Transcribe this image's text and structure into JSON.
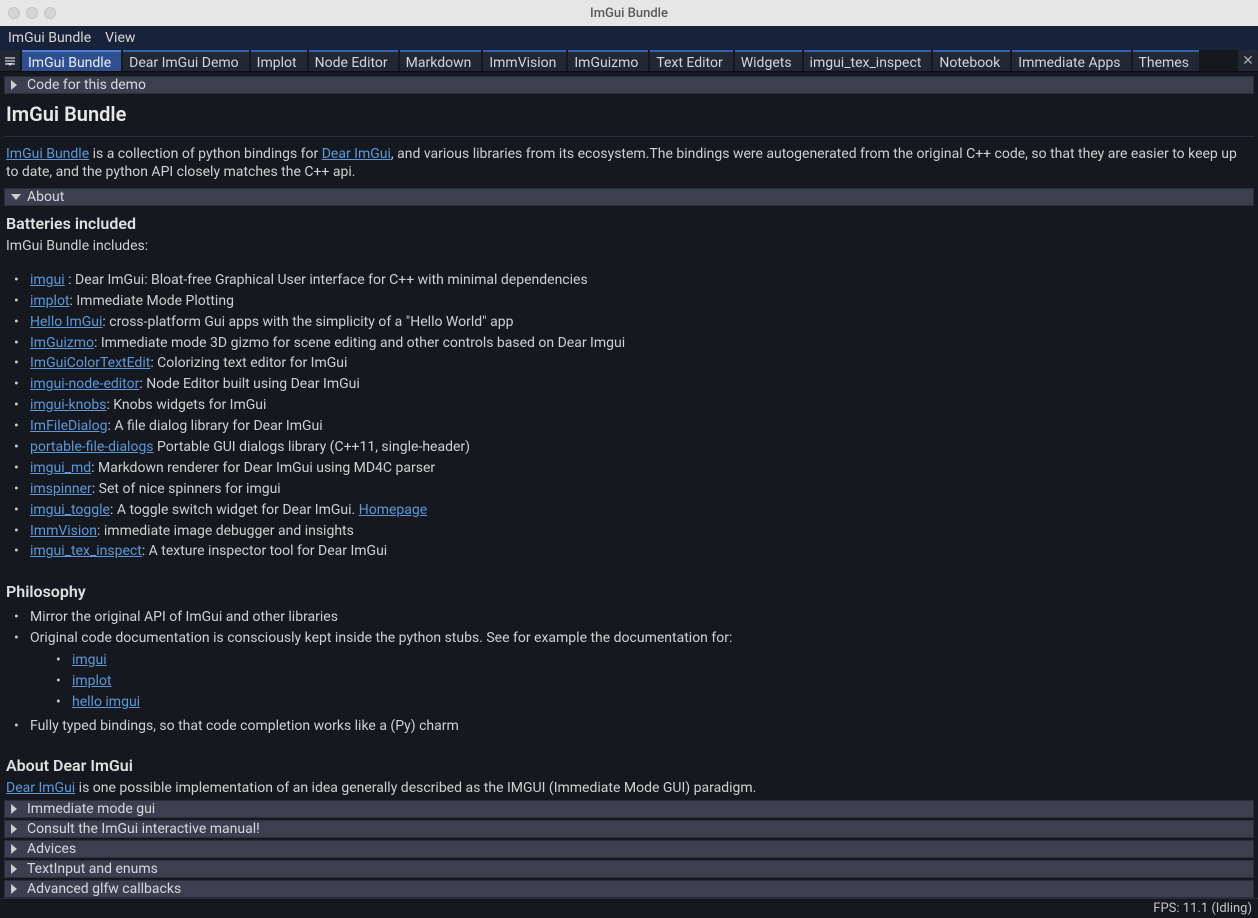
{
  "window": {
    "title": "ImGui Bundle"
  },
  "menubar": [
    "ImGui Bundle",
    "View"
  ],
  "tabs": [
    "ImGui Bundle",
    "Dear ImGui Demo",
    "Implot",
    "Node Editor",
    "Markdown",
    "ImmVision",
    "ImGuizmo",
    "Text Editor",
    "Widgets",
    "imgui_tex_inspect",
    "Notebook",
    "Immediate Apps",
    "Themes"
  ],
  "active_tab_index": 0,
  "collapsers": {
    "code_demo": "Code for this demo",
    "about": "About",
    "imm_mode": "Immediate mode gui",
    "consult": "Consult the ImGui interactive manual!",
    "advices": "Advices",
    "textinput": "TextInput and enums",
    "glfw": "Advanced glfw callbacks"
  },
  "heading": "ImGui Bundle",
  "intro": {
    "link1": "ImGui Bundle",
    "t1": " is a collection of python bindings for ",
    "link2": "Dear ImGui",
    "t2": ", and various libraries from its ecosystem.The bindings were autogenerated from the original C++ code, so that they are easier to keep up to date, and the python API closely matches the C++ api."
  },
  "batteries_heading": "Batteries included",
  "batteries_intro": "ImGui Bundle includes:",
  "items": [
    {
      "link": "imgui",
      "text": " : Dear ImGui: Bloat-free Graphical User interface for C++ with minimal dependencies"
    },
    {
      "link": "implot",
      "text": ": Immediate Mode Plotting"
    },
    {
      "link": "Hello ImGui",
      "text": ": cross-platform Gui apps with the simplicity of a \"Hello World\" app"
    },
    {
      "link": "ImGuizmo",
      "text": ": Immediate mode 3D gizmo for scene editing and other controls based on Dear Imgui"
    },
    {
      "link": "ImGuiColorTextEdit",
      "text": ": Colorizing text editor for ImGui"
    },
    {
      "link": "imgui-node-editor",
      "text": ": Node Editor built using Dear ImGui"
    },
    {
      "link": "imgui-knobs",
      "text": ": Knobs widgets for ImGui"
    },
    {
      "link": "ImFileDialog",
      "text": ": A file dialog library for Dear ImGui"
    },
    {
      "link": "portable-file-dialogs",
      "text": "  Portable GUI dialogs library (C++11, single-header)"
    },
    {
      "link": "imgui_md",
      "text": ": Markdown renderer for Dear ImGui using MD4C parser"
    },
    {
      "link": "imspinner",
      "text": ": Set of nice spinners for imgui"
    },
    {
      "link": "imgui_toggle",
      "text": ": A toggle switch widget for Dear ImGui. ",
      "link2": "Homepage"
    },
    {
      "link": "ImmVision",
      "text": ": immediate image debugger and insights"
    },
    {
      "link": "imgui_tex_inspect",
      "text": ": A texture inspector tool for Dear ImGui"
    }
  ],
  "philosophy_heading": "Philosophy",
  "philosophy": [
    "Mirror the original API of ImGui and other libraries",
    "Original code documentation is consciously kept inside the python stubs. See for example the documentation for:"
  ],
  "philosophy_sub": [
    "imgui",
    "implot",
    "hello imgui"
  ],
  "philosophy_last": "Fully typed bindings, so that code completion works like a (Py) charm",
  "about_heading": "About Dear ImGui",
  "about_para": {
    "link": "Dear ImGui",
    "text": " is one possible implementation of an idea generally described as the IMGUI (Immediate Mode GUI) paradigm."
  },
  "status": "FPS: 11.1 (Idling)"
}
